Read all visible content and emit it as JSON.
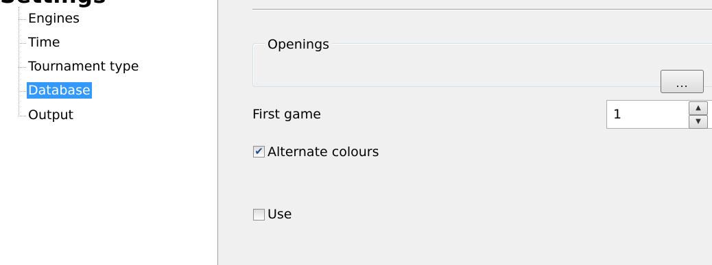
{
  "header": {
    "title": "Settings"
  },
  "tree": {
    "items": [
      {
        "label": "Engines"
      },
      {
        "label": "Time"
      },
      {
        "label": "Tournament type"
      },
      {
        "label": "Database"
      },
      {
        "label": "Output"
      }
    ],
    "selected": "Database"
  },
  "openings": {
    "group_title": "Openings",
    "browse_label": "..."
  },
  "first_game": {
    "label": "First game",
    "value": "1",
    "up_icon": "arrow-up-icon",
    "down_icon": "arrow-down-icon"
  },
  "alternate_colours": {
    "label": "Alternate colours",
    "checked": true,
    "mark": "✔"
  },
  "use": {
    "label": "Use",
    "checked": false
  },
  "colors": {
    "selection": "#3399ff",
    "panel_bg": "#f0f0f0"
  }
}
